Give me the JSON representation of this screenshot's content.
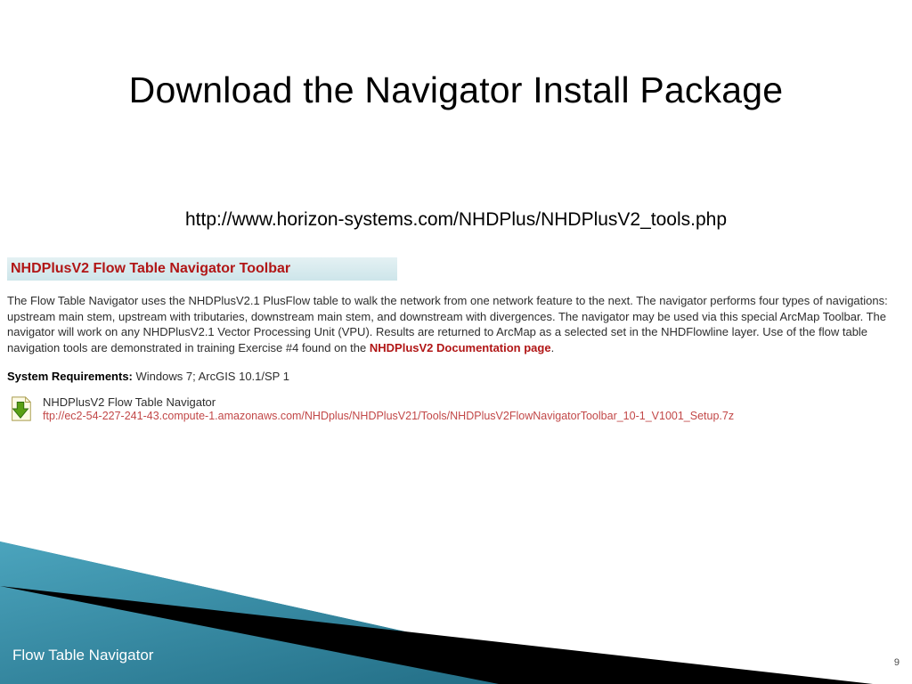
{
  "title": "Download the Navigator Install Package",
  "url": "http://www.horizon-systems.com/NHDPlus/NHDPlusV2_tools.php",
  "section_heading": "NHDPlusV2 Flow Table Navigator Toolbar",
  "description_part1": "The Flow Table Navigator uses the NHDPlusV2.1 PlusFlow table to walk the network from one network feature to the next. The navigator performs four types of navigations: upstream main stem, upstream with tributaries, downstream main stem, and downstream with divergences. The navigator may be used via this special ArcMap Toolbar. The navigator will work on any NHDPlusV2.1 Vector Processing Unit (VPU). Results are returned to ArcMap as a selected set in the NHDFlowline layer. Use of the flow table navigation tools are demonstrated in training Exercise #4 found on the ",
  "doc_link_text": "NHDPlusV2 Documentation page",
  "description_part2": ".",
  "sysreq_label": "System Requirements:",
  "sysreq_value": " Windows 7; ArcGIS 10.1/SP 1",
  "download_title": "NHDPlusV2 Flow Table Navigator",
  "download_link": "ftp://ec2-54-227-241-43.compute-1.amazonaws.com/NHDplus/NHDPlusV21/Tools/NHDPlusV2FlowNavigatorToolbar_10-1_V1001_Setup.7z",
  "footer_title": "Flow Table Navigator",
  "page_number": "9"
}
